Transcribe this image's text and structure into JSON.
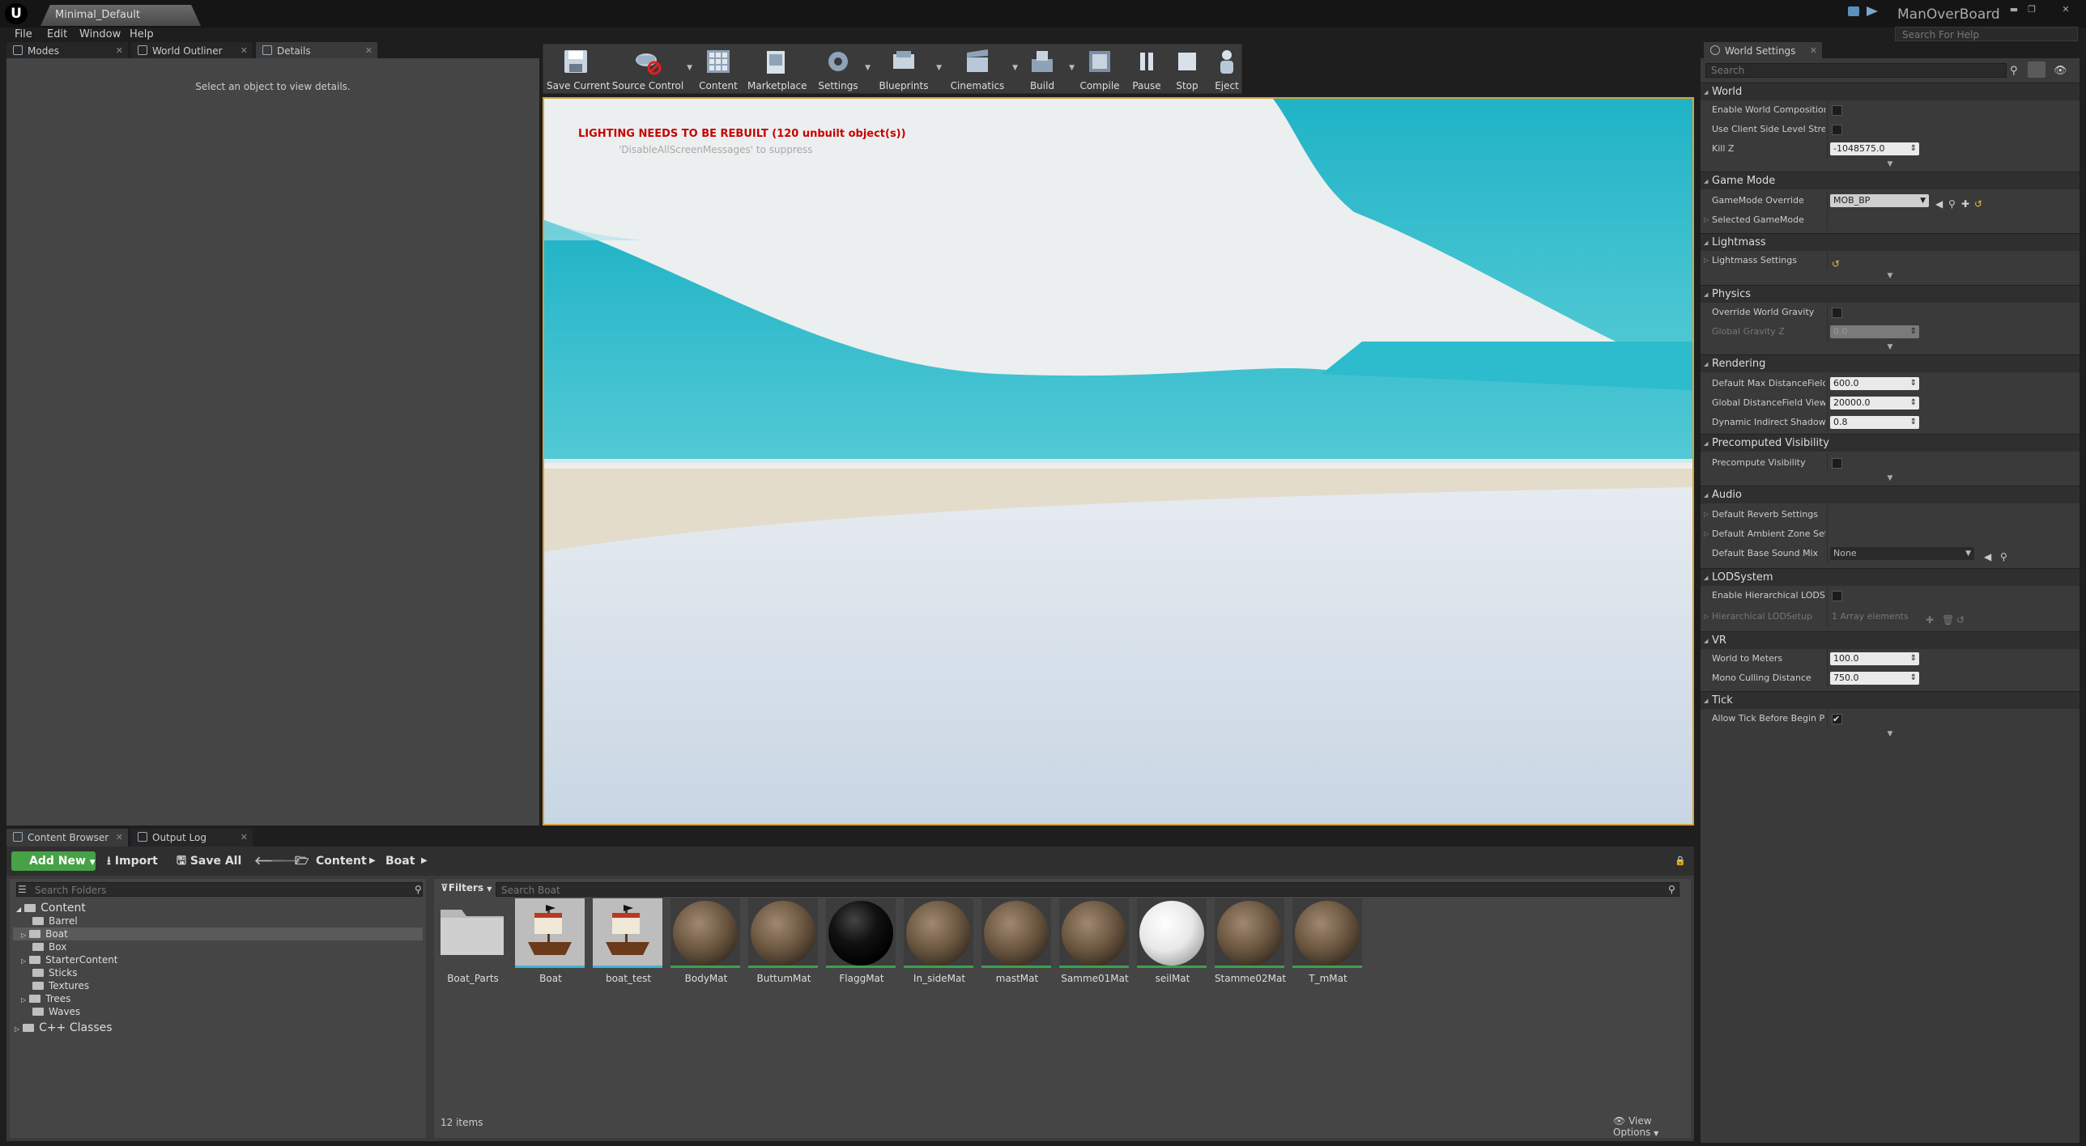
{
  "titlebar": {
    "doc_tab": "Minimal_Default",
    "project": "ManOverBoard",
    "help_search_placeholder": "Search For Help",
    "minimize": "▬",
    "maximize": "❐",
    "close": "✕"
  },
  "menu": [
    "File",
    "Edit",
    "Window",
    "Help"
  ],
  "left_tabs": [
    {
      "label": "Modes",
      "icon": "pencil-icon"
    },
    {
      "label": "World Outliner",
      "icon": "list-icon"
    },
    {
      "label": "Details",
      "icon": "info-icon"
    }
  ],
  "details_empty": "Select an object to view details.",
  "toolbar": [
    {
      "label": "Save Current",
      "icon": "save-icon"
    },
    {
      "label": "Source Control",
      "icon": "source-control-icon"
    },
    {
      "label": "Content",
      "icon": "content-icon"
    },
    {
      "label": "Marketplace",
      "icon": "marketplace-icon"
    },
    {
      "label": "Settings",
      "icon": "settings-icon"
    },
    {
      "label": "Blueprints",
      "icon": "blueprints-icon"
    },
    {
      "label": "Cinematics",
      "icon": "cinematics-icon"
    },
    {
      "label": "Build",
      "icon": "build-icon"
    },
    {
      "label": "Compile",
      "icon": "compile-icon"
    },
    {
      "label": "Pause",
      "icon": "pause-icon"
    },
    {
      "label": "Stop",
      "icon": "stop-icon"
    },
    {
      "label": "Eject",
      "icon": "eject-icon"
    }
  ],
  "viewport": {
    "warning": "LIGHTING NEEDS TO BE REBUILT (120 unbuilt object(s))",
    "sub": "'DisableAllScreenMessages' to suppress",
    "colors": {
      "sky": "#e8ecee",
      "water": "#37bccb",
      "sand": "#e4dcc8",
      "floor": "#d3dde8"
    }
  },
  "world_settings": {
    "tab": "World Settings",
    "search_placeholder": "Search",
    "sections": {
      "world": "World",
      "game_mode": "Game Mode",
      "lightmass": "Lightmass",
      "physics": "Physics",
      "rendering": "Rendering",
      "precomputed": "Precomputed Visibility",
      "audio": "Audio",
      "lod": "LODSystem",
      "vr": "VR",
      "tick": "Tick"
    },
    "rows": {
      "enable_world_composition": "Enable World Composition",
      "use_client_side": "Use Client Side Level Strear",
      "kill_z": "Kill Z",
      "kill_z_value": "-1048575.0",
      "gamemode_override": "GameMode Override",
      "gamemode_value": "MOB_BP",
      "selected_gamemode": "Selected GameMode",
      "lightmass_settings": "Lightmass Settings",
      "override_gravity": "Override World Gravity",
      "global_gravity": "Global Gravity Z",
      "global_gravity_value": "0.0",
      "default_max_df": "Default Max DistanceField C",
      "default_max_df_value": "600.0",
      "global_df_view": "Global DistanceField View D",
      "global_df_view_value": "20000.0",
      "dynamic_indirect": "Dynamic Indirect Shadows S",
      "dynamic_indirect_value": "0.8",
      "precompute_visibility": "Precompute Visibility",
      "default_reverb": "Default Reverb Settings",
      "default_ambient": "Default Ambient Zone Settir",
      "default_sound_mix": "Default Base Sound Mix",
      "sound_mix_value": "None",
      "enable_hlod": "Enable Hierarchical LODSys",
      "hierarchical_setup": "Hierarchical LODSetup",
      "hierarchical_value": "1 Array elements",
      "world_to_meters": "World to Meters",
      "world_to_meters_value": "100.0",
      "mono_culling": "Mono Culling Distance",
      "mono_culling_value": "750.0",
      "allow_tick": "Allow Tick Before Begin Pla"
    }
  },
  "content_browser": {
    "tabs": [
      "Content Browser",
      "Output Log"
    ],
    "add_new": "Add New",
    "import": "Import",
    "save_all": "Save All",
    "path": [
      "Content",
      "Boat"
    ],
    "folder_search": "Search Folders",
    "asset_search": "Search Boat",
    "filters": "Filters",
    "tree": [
      {
        "label": "Content",
        "level": 0,
        "selected": false
      },
      {
        "label": "Barrel",
        "level": 1,
        "selected": false
      },
      {
        "label": "Boat",
        "level": 1,
        "selected": true
      },
      {
        "label": "Box",
        "level": 1,
        "selected": false
      },
      {
        "label": "StarterContent",
        "level": 1,
        "selected": false
      },
      {
        "label": "Sticks",
        "level": 1,
        "selected": false
      },
      {
        "label": "Textures",
        "level": 1,
        "selected": false
      },
      {
        "label": "Trees",
        "level": 1,
        "selected": false
      },
      {
        "label": "Waves",
        "level": 1,
        "selected": false
      },
      {
        "label": "C++ Classes",
        "level": 0,
        "selected": false
      }
    ],
    "assets": [
      {
        "label": "Boat_Parts",
        "kind": "folder"
      },
      {
        "label": "Boat",
        "kind": "mesh"
      },
      {
        "label": "boat_test",
        "kind": "mesh"
      },
      {
        "label": "BodyMat",
        "kind": "mat-brown"
      },
      {
        "label": "ButtumMat",
        "kind": "mat-brown"
      },
      {
        "label": "FlaggMat",
        "kind": "mat-black"
      },
      {
        "label": "In_sideMat",
        "kind": "mat-brown"
      },
      {
        "label": "mastMat",
        "kind": "mat-brown"
      },
      {
        "label": "Samme01Mat",
        "kind": "mat-brown"
      },
      {
        "label": "seilMat",
        "kind": "mat-white"
      },
      {
        "label": "Stamme02Mat",
        "kind": "mat-brown"
      },
      {
        "label": "T_mMat",
        "kind": "mat-brown"
      }
    ],
    "item_count": "12 items",
    "view_options": "View Options"
  }
}
